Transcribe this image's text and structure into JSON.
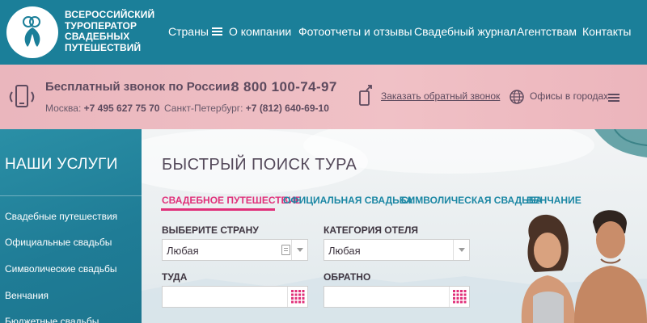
{
  "colors": {
    "header": "#1b7f99",
    "accent_pink": "#e0307a",
    "tab_blue": "#1b87a4",
    "text_dark": "#5d4a5e"
  },
  "logo": {
    "lines": [
      "Всероссийский",
      "туроператор",
      "свадебных",
      "путешествий"
    ]
  },
  "nav": {
    "items": [
      {
        "label": "Страны",
        "icon": "hamburger-icon"
      },
      {
        "label": "О компании"
      },
      {
        "label": "Фотоотчеты и отзывы"
      },
      {
        "label": "Свадебный журнал"
      },
      {
        "label": "Агентствам"
      },
      {
        "label": "Контакты"
      }
    ]
  },
  "callbar": {
    "title": "Бесплатный звонок по России:",
    "number": "8 800 100-74-97",
    "moscow_label": "Москва:",
    "moscow_number": "+7 495 627 75 70",
    "spb_label": "Санкт-Петербург:",
    "spb_number": "+7 (812) 640-69-10",
    "callback_link": "Заказать обратный звонок",
    "offices_link": "Офисы в городах"
  },
  "sidebar": {
    "title": "Наши услуги",
    "items": [
      "Свадебные путешествия",
      "Официальные свадьбы",
      "Символические свадьбы",
      "Венчания",
      "Бюджетные свадьбы"
    ]
  },
  "search": {
    "title": "Быстрый поиск тура",
    "tabs": [
      {
        "label": "Свадебное путешествие",
        "active": true
      },
      {
        "label": "Официальная свадьба",
        "active": false
      },
      {
        "label": "Символическая свадьба",
        "active": false
      },
      {
        "label": "Венчание",
        "active": false
      }
    ],
    "country_label": "Выберите страну",
    "country_value": "Любая",
    "hotel_label": "Категория отеля",
    "hotel_value": "Любая",
    "from_label": "Туда",
    "from_value": "",
    "back_label": "Обратно",
    "back_value": ""
  }
}
